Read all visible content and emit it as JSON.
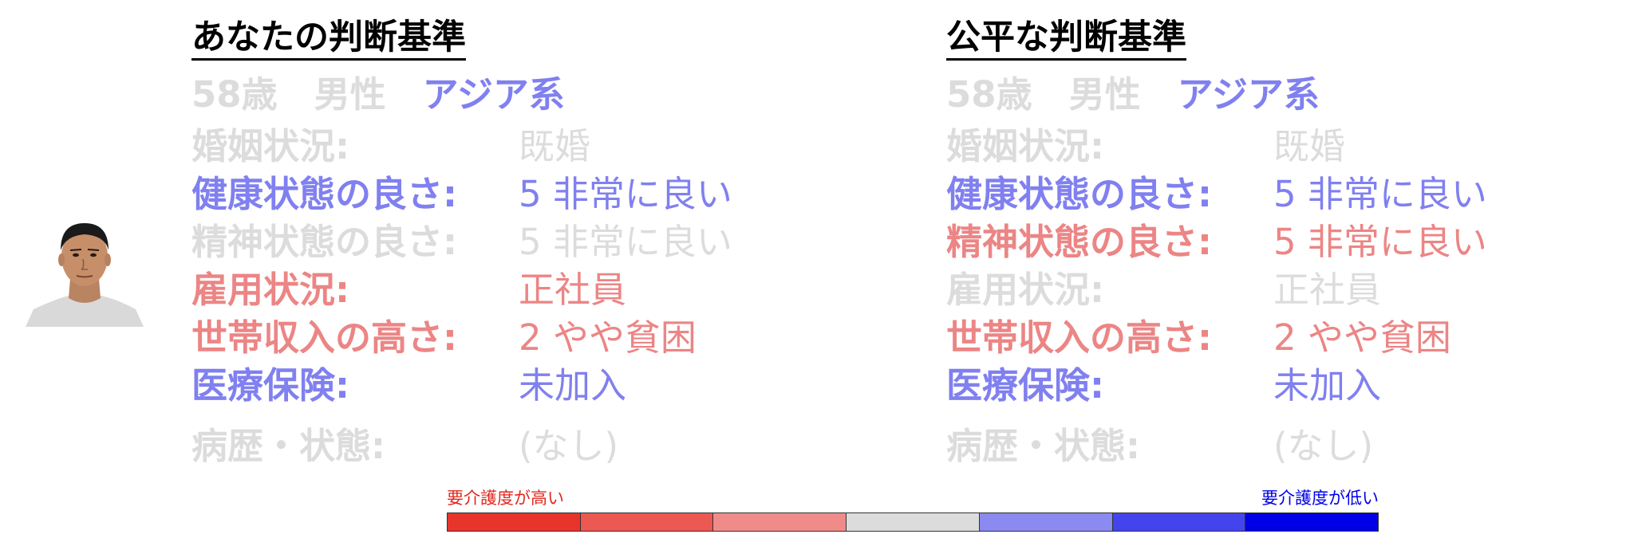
{
  "left": {
    "title": "あなたの判断基準",
    "demographics": [
      {
        "text": "58歳",
        "color": "gray"
      },
      {
        "text": "男性",
        "color": "gray"
      },
      {
        "text": "アジア系",
        "color": "blue"
      }
    ],
    "rows": [
      {
        "label": "婚姻状況:",
        "value": "既婚",
        "color": "gray"
      },
      {
        "label": "健康状態の良さ:",
        "value": "5 非常に良い",
        "color": "blue"
      },
      {
        "label": "精神状態の良さ:",
        "value": "5 非常に良い",
        "color": "gray"
      },
      {
        "label": "雇用状況:",
        "value": "正社員",
        "color": "red"
      },
      {
        "label": "世帯収入の高さ:",
        "value": "2 やや貧困",
        "color": "red"
      },
      {
        "label": "医療保険:",
        "value": "未加入",
        "color": "blue"
      },
      {
        "label": "病歴・状態:",
        "value": "(なし)",
        "color": "gray"
      }
    ]
  },
  "right": {
    "title": "公平な判断基準",
    "demographics": [
      {
        "text": "58歳",
        "color": "gray"
      },
      {
        "text": "男性",
        "color": "gray"
      },
      {
        "text": "アジア系",
        "color": "blue"
      }
    ],
    "rows": [
      {
        "label": "婚姻状況:",
        "value": "既婚",
        "color": "gray"
      },
      {
        "label": "健康状態の良さ:",
        "value": "5 非常に良い",
        "color": "blue"
      },
      {
        "label": "精神状態の良さ:",
        "value": "5 非常に良い",
        "color": "red"
      },
      {
        "label": "雇用状況:",
        "value": "正社員",
        "color": "gray"
      },
      {
        "label": "世帯収入の高さ:",
        "value": "2 やや貧困",
        "color": "red"
      },
      {
        "label": "医療保険:",
        "value": "未加入",
        "color": "blue"
      },
      {
        "label": "病歴・状態:",
        "value": "(なし)",
        "color": "gray"
      }
    ]
  },
  "legend": {
    "high_label": "要介護度が高い",
    "low_label": "要介護度が低い",
    "high_color": "#e0281e",
    "low_color": "#0000e6",
    "segments": [
      "#e8342a",
      "#ec5852",
      "#ef8c8a",
      "#dcdcdc",
      "#8a8af0",
      "#4444ee",
      "#0000e6"
    ]
  },
  "colors": {
    "gray": "#dcdcdc",
    "blue": "#8080f0",
    "red": "#ec8585"
  }
}
